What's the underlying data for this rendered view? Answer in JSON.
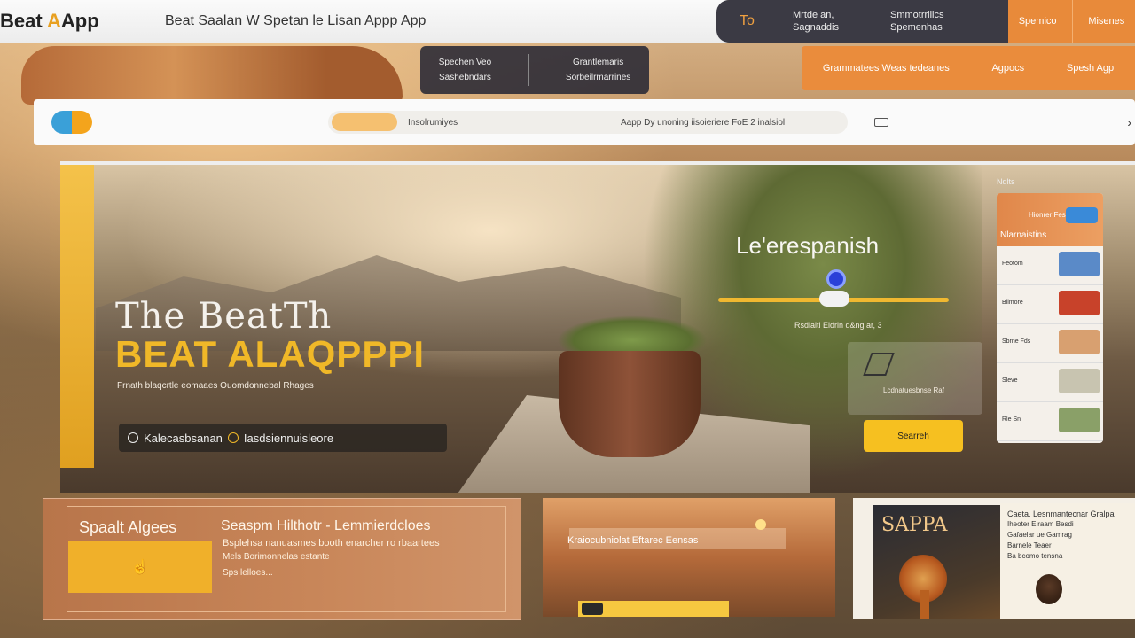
{
  "topbar": {
    "logo_prefix": "Beat ",
    "logo_accent": "A",
    "logo_suffix": "App",
    "title": "Beat Saalan W Spetan le Lisan Appp App"
  },
  "dark_panel": {
    "label": "To",
    "col1": [
      "Mrtde an,",
      "Sagnaddis"
    ],
    "col2": [
      "Smmotrrilics",
      "Spemenhas"
    ]
  },
  "orange_tabs": [
    "Spemico",
    "Misenes"
  ],
  "sub_panel": {
    "col1": [
      "Spechen Veo",
      "Sashebndars"
    ],
    "col2": [
      "Grantlemaris",
      "Sorbeilrmarrines"
    ]
  },
  "orange_nav": [
    "Grammatees Weas tedeanes",
    "Agpocs",
    "Spesh Agp"
  ],
  "search": {
    "placeholder": "Insolrumiyes",
    "right_text": "Aapp  Dy unoning iisoieriere FoE 2 inalsiol"
  },
  "hero": {
    "title_line1": "The BeatTh",
    "title_line2": "BEAT  ALAQPPPI",
    "subtitle": "Frnath blaqcrtle eomaaes Ouomdonnebal Rhages",
    "pill_label": "Kalecasbsanan",
    "pill_label_2": "Iasdsiennuisleore",
    "right_title": "Le'erespanish",
    "slider_caption": "Rsdlaltl Eldrin d&ng ar, 3",
    "glass_text": "Lcdnatuesbnse Raf",
    "search_cta": "Searreh",
    "side_card_label": "Ndlts",
    "side_card_head": "Nlarnaistins",
    "side_card_head_caption": "Hionrer Fes",
    "side_card_rows": [
      "Feotom",
      "Bllmore",
      "Sbrne Fds",
      "Sleve",
      "Rle Sn"
    ]
  },
  "bottom_orange": {
    "title": "Spaalt Algees",
    "heading": "Seaspm Hilthotr - Lemmierdcloes",
    "line1": "Bsplehsa nanuasmes booth enarcher ro rbaartees",
    "line2": "Mels Borimonnelas estante",
    "line3": "Sps lelloes...",
    "cta_icon": "hand-pointer-icon",
    "cta_glyph": "☝"
  },
  "bottom_mid": {
    "label": "Kraiocubniolat Eftarec Eensas"
  },
  "bottom_right": {
    "card_title": "SAPPA",
    "paper_heading": "Caeta. Lesnmantecnar Gralpa",
    "paper_lines": [
      "Iheoter Elraam Besdi",
      "Gafaelar ue Gamrag",
      "Barnele Teaer",
      "Ba bcomo tensna"
    ]
  },
  "colors": {
    "accent_yellow": "#f0b828",
    "accent_orange": "#e88a3a",
    "dark_panel": "#3b3a44"
  }
}
